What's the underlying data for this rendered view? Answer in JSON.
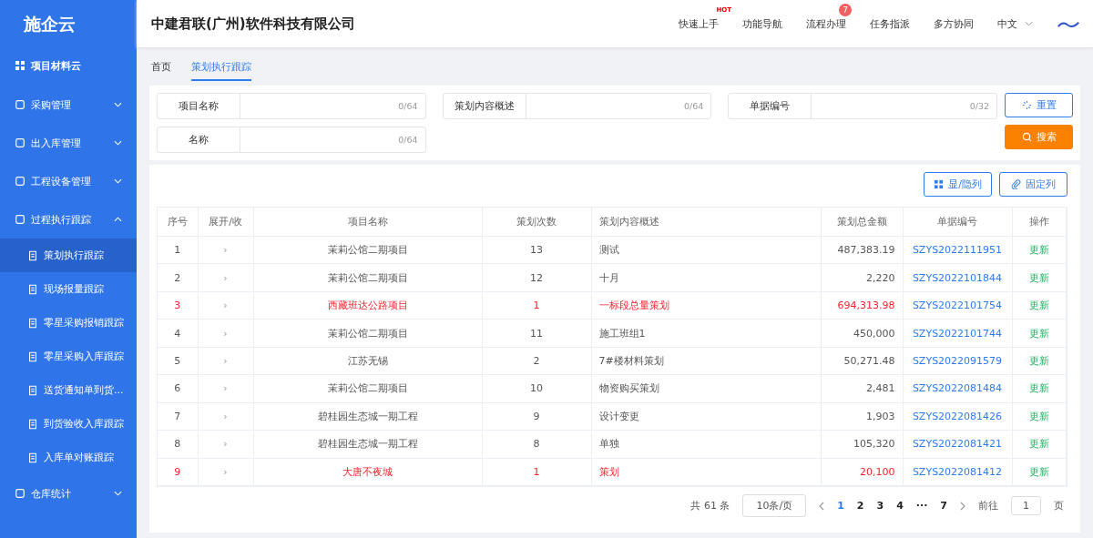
{
  "sidebar": {
    "logo": "施企云",
    "app_title": "项目材料云",
    "menu": [
      {
        "label": "采购管理",
        "expanded": false
      },
      {
        "label": "出入库管理",
        "expanded": false
      },
      {
        "label": "工程设备管理",
        "expanded": false
      },
      {
        "label": "过程执行跟踪",
        "expanded": true,
        "children": [
          {
            "label": "策划执行跟踪",
            "selected": true
          },
          {
            "label": "现场报量跟踪",
            "selected": false
          },
          {
            "label": "零星采购报销跟踪",
            "selected": false
          },
          {
            "label": "零星采购入库跟踪",
            "selected": false
          },
          {
            "label": "送货通知单到货...",
            "selected": false
          },
          {
            "label": "到货验收入库跟踪",
            "selected": false
          },
          {
            "label": "入库单对账跟踪",
            "selected": false
          }
        ]
      },
      {
        "label": "仓库统计",
        "expanded": false
      }
    ]
  },
  "header": {
    "company": "中建君联(广州)软件科技有限公司",
    "nav": [
      {
        "label": "快速上手",
        "kind": "hot",
        "badge": "HOT"
      },
      {
        "label": "功能导航",
        "kind": "plain"
      },
      {
        "label": "流程办理",
        "kind": "count",
        "badge": "7"
      },
      {
        "label": "任务指派",
        "kind": "plain"
      },
      {
        "label": "多方协同",
        "kind": "plain"
      }
    ],
    "language": "中文"
  },
  "tabs": [
    {
      "label": "首页",
      "selected": false
    },
    {
      "label": "策划执行跟踪",
      "selected": true
    }
  ],
  "filters": [
    {
      "label": "项目名称",
      "counter": "0/64"
    },
    {
      "label": "策划内容概述",
      "counter": "0/64"
    },
    {
      "label": "单据编号",
      "counter": "0/32"
    },
    {
      "label": "名称",
      "counter": "0/64"
    }
  ],
  "reset_button": "重置",
  "search_button": "搜索",
  "table_tools": [
    {
      "label": "显/隐列",
      "kind": "grid"
    },
    {
      "label": "固定列",
      "kind": "clip"
    }
  ],
  "table": {
    "columns": [
      "序号",
      "展开/收",
      "项目名称",
      "策划次数",
      "策划内容概述",
      "策划总金额",
      "单据编号",
      "操作"
    ],
    "rows": [
      {
        "alert": false,
        "cells": [
          "1",
          "›",
          "茉莉公馆二期项目",
          "13",
          "测试",
          "487,383.19",
          "SZYS2022111951",
          "更新"
        ]
      },
      {
        "alert": false,
        "cells": [
          "2",
          "›",
          "茉莉公馆二期项目",
          "12",
          "十月",
          "2,220",
          "SZYS2022101844",
          "更新"
        ]
      },
      {
        "alert": true,
        "cells": [
          "3",
          "›",
          "西藏班达公路项目",
          "1",
          "一标段总量策划",
          "694,313.98",
          "SZYS2022101754",
          "更新"
        ]
      },
      {
        "alert": false,
        "cells": [
          "4",
          "›",
          "茉莉公馆二期项目",
          "11",
          "施工班组1",
          "450,000",
          "SZYS2022101744",
          "更新"
        ]
      },
      {
        "alert": false,
        "cells": [
          "5",
          "›",
          "江苏无锡",
          "2",
          "7#楼材料策划",
          "50,271.48",
          "SZYS2022091579",
          "更新"
        ]
      },
      {
        "alert": false,
        "cells": [
          "6",
          "›",
          "茉莉公馆二期项目",
          "10",
          "物资购买策划",
          "2,481",
          "SZYS2022081484",
          "更新"
        ]
      },
      {
        "alert": false,
        "cells": [
          "7",
          "›",
          "碧桂园生态城一期工程",
          "9",
          "设计变更",
          "1,903",
          "SZYS2022081426",
          "更新"
        ]
      },
      {
        "alert": false,
        "cells": [
          "8",
          "›",
          "碧桂园生态城一期工程",
          "8",
          "单独",
          "105,320",
          "SZYS2022081421",
          "更新"
        ]
      },
      {
        "alert": true,
        "cells": [
          "9",
          "›",
          "大唐不夜城",
          "1",
          "策划",
          "20,100",
          "SZYS2022081412",
          "更新"
        ]
      }
    ]
  },
  "pagination": {
    "total": "共 61 条",
    "page_size": "10条/页",
    "pages": [
      {
        "label": "1",
        "selected": true
      },
      {
        "label": "2",
        "selected": false
      },
      {
        "label": "3",
        "selected": false
      },
      {
        "label": "4",
        "selected": false
      },
      {
        "label": "···",
        "selected": false
      },
      {
        "label": "7",
        "selected": false
      }
    ],
    "goto_label": "前往",
    "goto_value": "1",
    "page_unit": "页"
  }
}
